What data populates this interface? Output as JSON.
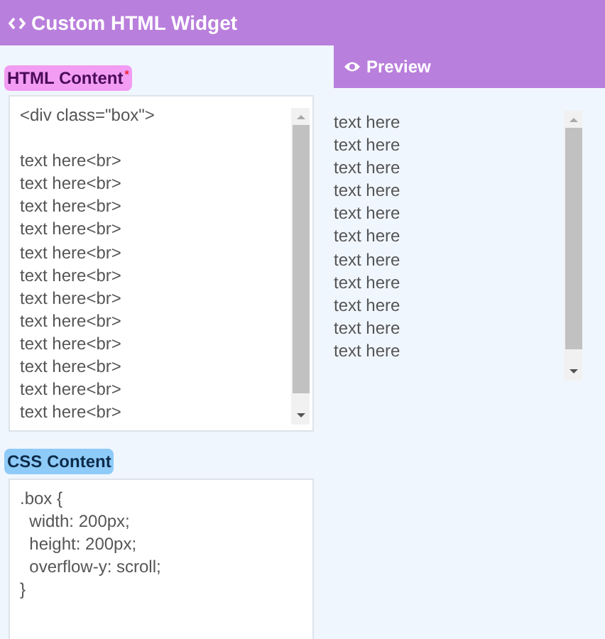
{
  "header": {
    "title": "Custom HTML Widget"
  },
  "html_section": {
    "label": "HTML Content",
    "required_mark": "*",
    "opening_line": "<div class=\"box\">",
    "lines": [
      "text here<br>",
      "text here<br>",
      "text here<br>",
      "text here<br>",
      "text here<br>",
      "text here<br>",
      "text here<br>",
      "text here<br>",
      "text here<br>",
      "text here<br>",
      "text here<br>",
      "text here<br>"
    ]
  },
  "css_section": {
    "label": "CSS Content",
    "lines": [
      ".box {",
      "  width: 200px;",
      "  height: 200px;",
      "  overflow-y: scroll;",
      "}"
    ]
  },
  "preview": {
    "tab": "Preview",
    "lines": [
      "text here",
      "text here",
      "text here",
      "text here",
      "text here",
      "text here",
      "text here",
      "text here",
      "text here",
      "text here",
      "text here"
    ]
  }
}
